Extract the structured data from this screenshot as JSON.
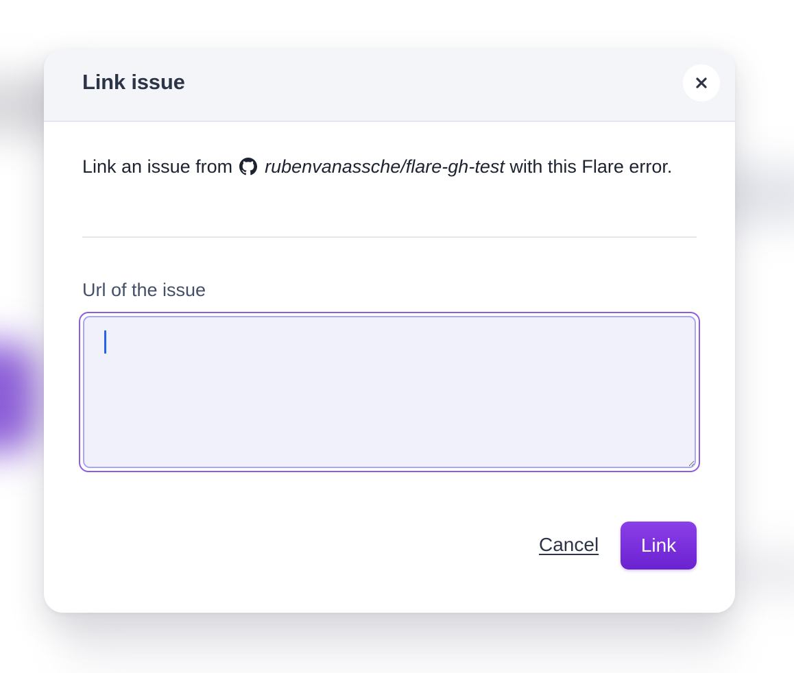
{
  "modal": {
    "title": "Link issue",
    "close_icon": "close-icon",
    "description": {
      "prefix": "Link an issue from",
      "repo_icon": "github-icon",
      "repo": "rubenvanassche/flare-gh-test",
      "suffix": "with this Flare error."
    },
    "field": {
      "label": "Url of the issue",
      "value": "",
      "placeholder": ""
    },
    "actions": {
      "cancel_label": "Cancel",
      "link_label": "Link"
    }
  },
  "colors": {
    "accent": "#7c3aed",
    "focus_ring": "#8d5ce0",
    "header_bg": "#f4f5f9",
    "title_text": "#2c3547"
  }
}
